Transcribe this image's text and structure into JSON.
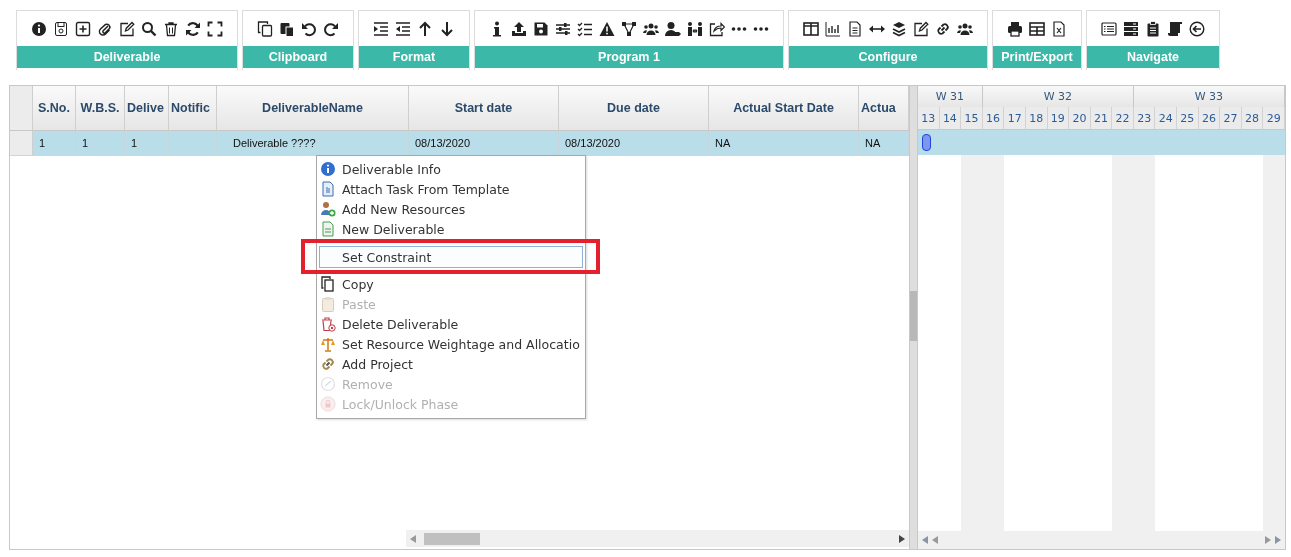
{
  "toolbar": {
    "groups": [
      {
        "label": "Deliverable"
      },
      {
        "label": "Clipboard"
      },
      {
        "label": "Format"
      },
      {
        "label": "Program 1"
      },
      {
        "label": "Configure"
      },
      {
        "label": "Print/Export"
      },
      {
        "label": "Navigate"
      }
    ]
  },
  "grid": {
    "columns": [
      "S.No.",
      "W.B.S.",
      "Delive",
      "Notific",
      "DeliverableName",
      "Start date",
      "Due date",
      "Actual Start Date",
      "Actua"
    ],
    "rows": [
      {
        "selected": true,
        "cells": [
          "1",
          "1",
          "1",
          "",
          "Deliverable ????",
          "08/13/2020",
          "08/13/2020",
          "NA",
          "NA"
        ]
      }
    ]
  },
  "gantt": {
    "weeks": [
      "W 31",
      "W 32",
      "W 33"
    ],
    "days": [
      {
        "label": "13",
        "weekend": false
      },
      {
        "label": "14",
        "weekend": false
      },
      {
        "label": "15",
        "weekend": true
      },
      {
        "label": "16",
        "weekend": true
      },
      {
        "label": "17",
        "weekend": false
      },
      {
        "label": "18",
        "weekend": false
      },
      {
        "label": "19",
        "weekend": false
      },
      {
        "label": "20",
        "weekend": false
      },
      {
        "label": "21",
        "weekend": false
      },
      {
        "label": "22",
        "weekend": true
      },
      {
        "label": "23",
        "weekend": true
      },
      {
        "label": "24",
        "weekend": false
      },
      {
        "label": "25",
        "weekend": false
      },
      {
        "label": "26",
        "weekend": false
      },
      {
        "label": "27",
        "weekend": false
      },
      {
        "label": "28",
        "weekend": false
      },
      {
        "label": "29",
        "weekend": true
      }
    ]
  },
  "context_menu": {
    "items": [
      {
        "label": "Deliverable Info",
        "disabled": false,
        "hovered": false
      },
      {
        "label": "Attach Task From Template",
        "disabled": false,
        "hovered": false
      },
      {
        "label": "Add New Resources",
        "disabled": false,
        "hovered": false
      },
      {
        "label": "New Deliverable",
        "disabled": false,
        "hovered": false
      },
      {
        "label": "Set Constraint",
        "disabled": false,
        "hovered": true
      },
      {
        "label": "Copy",
        "disabled": false,
        "hovered": false
      },
      {
        "label": "Paste",
        "disabled": true,
        "hovered": false
      },
      {
        "label": "Delete Deliverable",
        "disabled": false,
        "hovered": false
      },
      {
        "label": "Set Resource Weightage and Allocatio",
        "disabled": false,
        "hovered": false
      },
      {
        "label": "Add Project",
        "disabled": false,
        "hovered": false
      },
      {
        "label": "Remove",
        "disabled": true,
        "hovered": false
      },
      {
        "label": "Lock/Unlock Phase",
        "disabled": true,
        "hovered": false
      }
    ]
  }
}
